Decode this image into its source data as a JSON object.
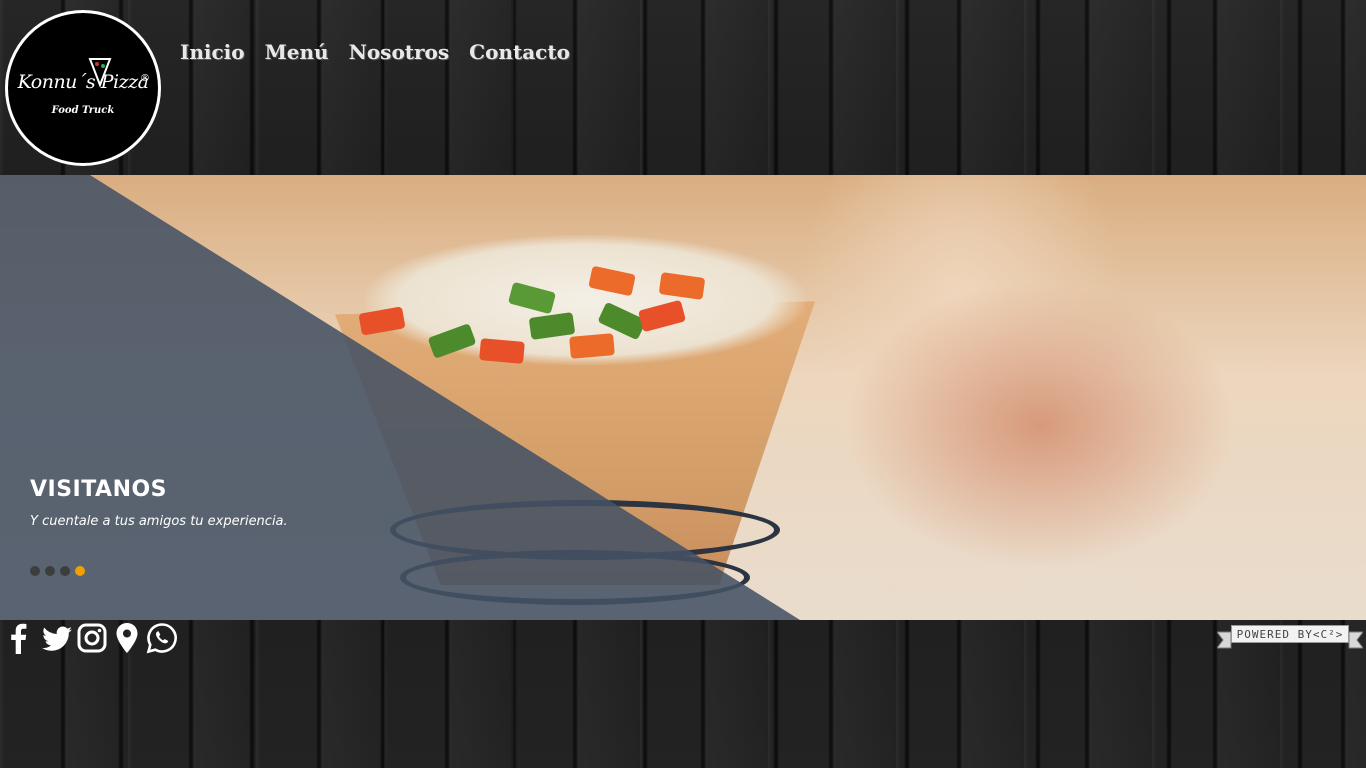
{
  "brand": {
    "name": "Konnu´s Pizza",
    "registered": "®",
    "subtitle": "Food Truck"
  },
  "nav": {
    "items": [
      "Inicio",
      "Menú",
      "Nosotros",
      "Contacto"
    ]
  },
  "slider": {
    "title": "VISITANOS",
    "text": "Y cuentale a tus amigos tu experiencia.",
    "slide_count": 4,
    "active_slide": 4,
    "active_dot_color": "#f0a000"
  },
  "social": [
    "facebook-icon",
    "twitter-icon",
    "instagram-icon",
    "map-pin-icon",
    "whatsapp-icon"
  ],
  "powered": {
    "label": "POWERED BY<C²>"
  }
}
